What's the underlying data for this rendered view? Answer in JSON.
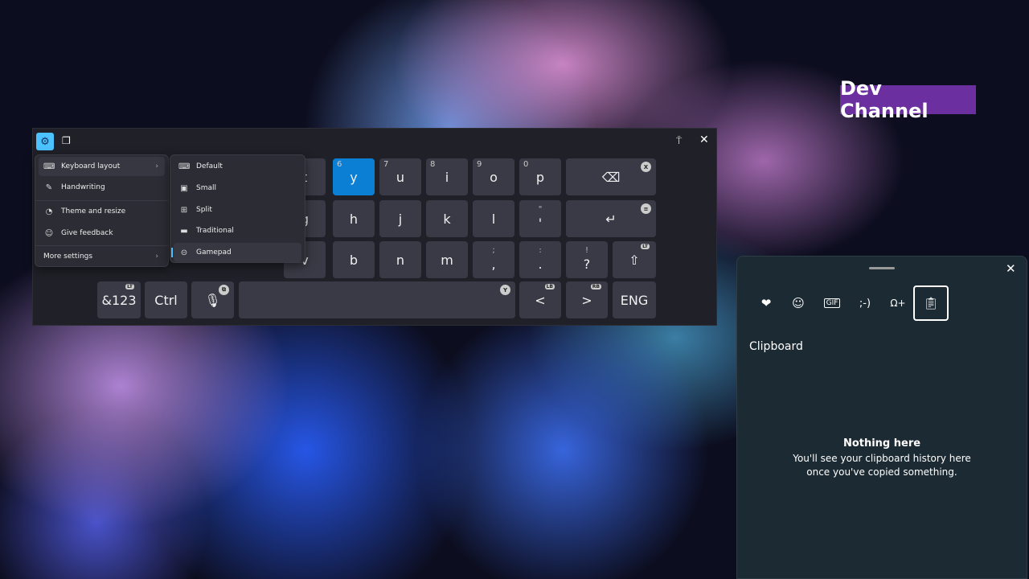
{
  "watermark": "Dev Channel",
  "keyboard": {
    "toolbar": {
      "settings_icon": "gear-icon",
      "clipboard_icon": "emoji-clipboard-icon",
      "dock_icon": "dock-icon",
      "close_icon": "close-icon"
    },
    "settings_menu": [
      {
        "label": "Keyboard layout",
        "icon": "keyboard-icon",
        "has_submenu": true
      },
      {
        "label": "Handwriting",
        "icon": "handwriting-icon"
      },
      {
        "label": "Theme and resize",
        "icon": "palette-icon"
      },
      {
        "label": "Give feedback",
        "icon": "feedback-icon"
      },
      {
        "label": "More settings",
        "has_submenu": true
      }
    ],
    "layout_submenu": [
      {
        "label": "Default",
        "icon": "keyboard-icon"
      },
      {
        "label": "Small",
        "icon": "small-keyboard-icon"
      },
      {
        "label": "Split",
        "icon": "split-keyboard-icon"
      },
      {
        "label": "Traditional",
        "icon": "traditional-keyboard-icon"
      },
      {
        "label": "Gamepad",
        "icon": "gamepad-icon",
        "selected": true
      }
    ],
    "keys": {
      "t": "t",
      "y": "y",
      "y_num": "6",
      "u": "u",
      "u_num": "7",
      "i": "i",
      "i_num": "8",
      "o": "o",
      "o_num": "9",
      "p": "p",
      "p_num": "0",
      "backspace_badge": "X",
      "g": "g",
      "h": "h",
      "j": "j",
      "k": "k",
      "l": "l",
      "quote_top": "\"",
      "quote": "'",
      "enter_badge": "≡",
      "v": "v",
      "b": "b",
      "n": "n",
      "m": "m",
      "comma": ",",
      "semicolon": ";",
      "period": ".",
      "colon": ":",
      "question": "?",
      "exclaim": "!",
      "shift_tag": "LT",
      "sym": "&123",
      "sym_tag": "LT",
      "ctrl": "Ctrl",
      "mic_badge": "⧉",
      "space_badge": "Y",
      "left": "<",
      "left_tag": "LB",
      "right": ">",
      "right_tag": "RB",
      "lang": "ENG"
    },
    "accent": "#0a7fd4"
  },
  "clipboard_panel": {
    "tabs": [
      "emoji-favorites-icon",
      "emoji-icon",
      "gif-icon",
      "kaomoji-icon",
      "symbols-icon",
      "clipboard-icon"
    ],
    "selected_tab": "clipboard-icon",
    "title": "Clipboard",
    "empty_title": "Nothing here",
    "empty_text": "You'll see your clipboard history here once you've copied something."
  }
}
